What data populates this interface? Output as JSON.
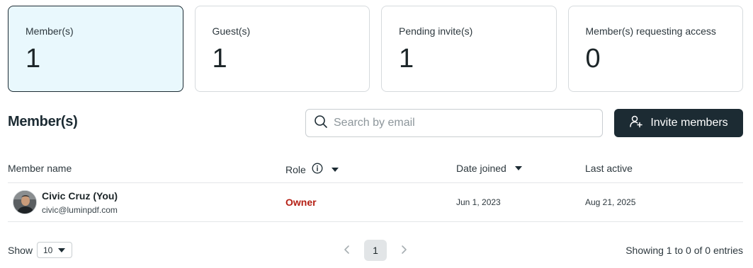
{
  "stats": [
    {
      "label": "Member(s)",
      "value": "1"
    },
    {
      "label": "Guest(s)",
      "value": "1"
    },
    {
      "label": "Pending invite(s)",
      "value": "1"
    },
    {
      "label": "Member(s) requesting access",
      "value": "0"
    }
  ],
  "section": {
    "title": "Member(s)"
  },
  "search": {
    "placeholder": "Search by email",
    "value": ""
  },
  "invite": {
    "label": "Invite members"
  },
  "table": {
    "headers": {
      "name": "Member name",
      "role": "Role",
      "date_joined": "Date joined",
      "last_active": "Last active"
    },
    "rows": [
      {
        "name": "Civic Cruz (You)",
        "email": "civic@luminpdf.com",
        "role": "Owner",
        "date_joined": "Jun 1, 2023",
        "last_active": "Aug 21, 2025"
      }
    ]
  },
  "footer": {
    "show_label": "Show",
    "page_size": "10",
    "current_page": "1",
    "entries_info": "Showing 1 to 0 of 0 entries"
  },
  "colors": {
    "accent_dark": "#1c2b33",
    "active_card_bg": "#e9f8fd",
    "owner_role": "#b51f14"
  },
  "icons": {
    "search": "search-icon",
    "invite": "add-user-icon",
    "role_info": "info-icon",
    "sort": "caret-down-icon",
    "prev": "chevron-left-icon",
    "next": "chevron-right-icon"
  }
}
